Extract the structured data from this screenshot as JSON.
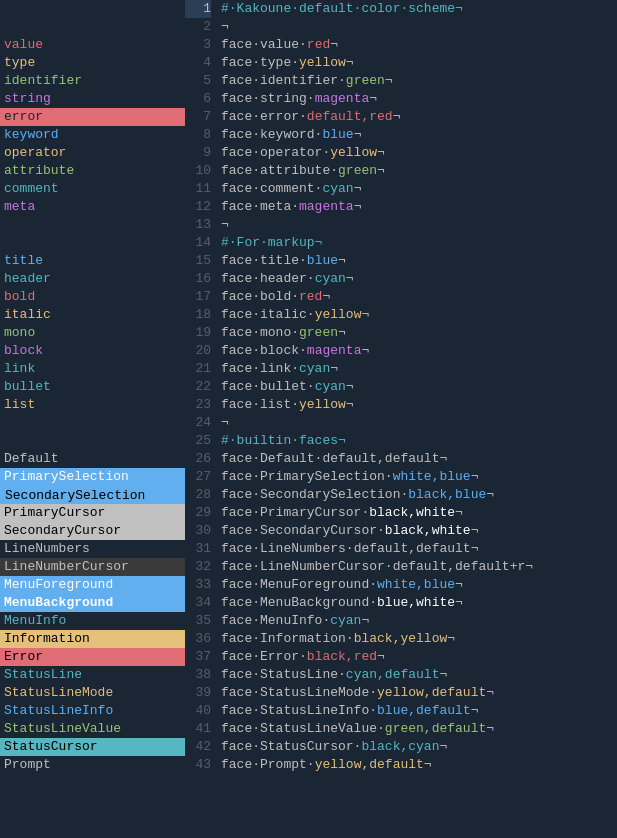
{
  "lines": [
    {
      "num": 1,
      "active": true,
      "left": "",
      "code": "#·Kakoune·default·color·scheme¬",
      "leftClass": "",
      "codeSegments": [
        {
          "text": "#·Kakoune·default·color·scheme¬",
          "cls": "c-comment"
        }
      ]
    },
    {
      "num": 2,
      "left": "",
      "code": "¬",
      "leftClass": "",
      "codeSegments": [
        {
          "text": "¬",
          "cls": "c-default"
        }
      ]
    },
    {
      "num": 3,
      "left": "value",
      "leftClass": "lbl-value",
      "code": "face·value·red¬",
      "codeSegments": [
        {
          "text": "face·",
          "cls": "c-default"
        },
        {
          "text": "value",
          "cls": "c-default"
        },
        {
          "text": "·",
          "cls": "c-default"
        },
        {
          "text": "red",
          "cls": "c-red"
        },
        {
          "text": "¬",
          "cls": "c-default"
        }
      ]
    },
    {
      "num": 4,
      "left": "type",
      "leftClass": "lbl-type",
      "code": "face·type·yellow¬",
      "codeSegments": [
        {
          "text": "face·type·",
          "cls": "c-default"
        },
        {
          "text": "yellow",
          "cls": "c-yellow"
        },
        {
          "text": "¬",
          "cls": "c-default"
        }
      ]
    },
    {
      "num": 5,
      "left": "identifier",
      "leftClass": "lbl-identifier",
      "code": "face·identifier·green¬",
      "codeSegments": [
        {
          "text": "face·identifier·",
          "cls": "c-default"
        },
        {
          "text": "green",
          "cls": "c-green"
        },
        {
          "text": "¬",
          "cls": "c-default"
        }
      ]
    },
    {
      "num": 6,
      "left": "string",
      "leftClass": "lbl-string",
      "code": "face·string·magenta¬",
      "codeSegments": [
        {
          "text": "face·string·",
          "cls": "c-default"
        },
        {
          "text": "magenta",
          "cls": "c-magenta"
        },
        {
          "text": "¬",
          "cls": "c-default"
        }
      ]
    },
    {
      "num": 7,
      "left": "error",
      "leftClass": "lbl-error",
      "code": "face·error·default,red¬",
      "codeSegments": [
        {
          "text": "face·error·",
          "cls": "c-default"
        },
        {
          "text": "default,red",
          "cls": "c-red"
        },
        {
          "text": "¬",
          "cls": "c-default"
        }
      ]
    },
    {
      "num": 8,
      "left": "keyword",
      "leftClass": "lbl-keyword",
      "code": "face·keyword·blue¬",
      "codeSegments": [
        {
          "text": "face·keyword·",
          "cls": "c-default"
        },
        {
          "text": "blue",
          "cls": "c-blue"
        },
        {
          "text": "¬",
          "cls": "c-default"
        }
      ]
    },
    {
      "num": 9,
      "left": "operator",
      "leftClass": "lbl-operator",
      "code": "face·operator·yellow¬",
      "codeSegments": [
        {
          "text": "face·operator·",
          "cls": "c-default"
        },
        {
          "text": "yellow",
          "cls": "c-yellow"
        },
        {
          "text": "¬",
          "cls": "c-default"
        }
      ]
    },
    {
      "num": 10,
      "left": "attribute",
      "leftClass": "lbl-attribute",
      "code": "face·attribute·green¬",
      "codeSegments": [
        {
          "text": "face·attribute·",
          "cls": "c-default"
        },
        {
          "text": "green",
          "cls": "c-green"
        },
        {
          "text": "¬",
          "cls": "c-default"
        }
      ]
    },
    {
      "num": 11,
      "left": "comment",
      "leftClass": "lbl-comment",
      "code": "face·comment·cyan¬",
      "codeSegments": [
        {
          "text": "face·comment·",
          "cls": "c-default"
        },
        {
          "text": "cyan",
          "cls": "c-cyan"
        },
        {
          "text": "¬",
          "cls": "c-default"
        }
      ]
    },
    {
      "num": 12,
      "left": "meta",
      "leftClass": "lbl-meta",
      "code": "face·meta·magenta¬",
      "codeSegments": [
        {
          "text": "face·meta·",
          "cls": "c-default"
        },
        {
          "text": "magenta",
          "cls": "c-magenta"
        },
        {
          "text": "¬",
          "cls": "c-default"
        }
      ]
    },
    {
      "num": 13,
      "left": "",
      "leftClass": "",
      "code": "¬",
      "codeSegments": [
        {
          "text": "¬",
          "cls": "c-default"
        }
      ]
    },
    {
      "num": 14,
      "left": "",
      "leftClass": "",
      "code": "#·For·markup¬",
      "codeSegments": [
        {
          "text": "#·For·markup¬",
          "cls": "c-comment"
        }
      ]
    },
    {
      "num": 15,
      "left": "title",
      "leftClass": "lbl-title",
      "code": "face·title·blue¬",
      "codeSegments": [
        {
          "text": "face·title·",
          "cls": "c-default"
        },
        {
          "text": "blue",
          "cls": "c-blue"
        },
        {
          "text": "¬",
          "cls": "c-default"
        }
      ]
    },
    {
      "num": 16,
      "left": "header",
      "leftClass": "lbl-header",
      "code": "face·header·cyan¬",
      "codeSegments": [
        {
          "text": "face·header·",
          "cls": "c-default"
        },
        {
          "text": "cyan",
          "cls": "c-cyan"
        },
        {
          "text": "¬",
          "cls": "c-default"
        }
      ]
    },
    {
      "num": 17,
      "left": "bold",
      "leftClass": "lbl-bold",
      "code": "face·bold·red¬",
      "codeSegments": [
        {
          "text": "face·bold·",
          "cls": "c-default"
        },
        {
          "text": "red",
          "cls": "c-red"
        },
        {
          "text": "¬",
          "cls": "c-default"
        }
      ]
    },
    {
      "num": 18,
      "left": "italic",
      "leftClass": "lbl-italic",
      "code": "face·italic·yellow¬",
      "codeSegments": [
        {
          "text": "face·italic·",
          "cls": "c-default"
        },
        {
          "text": "yellow",
          "cls": "c-yellow"
        },
        {
          "text": "¬",
          "cls": "c-default"
        }
      ]
    },
    {
      "num": 19,
      "left": "mono",
      "leftClass": "lbl-mono",
      "code": "face·mono·green¬",
      "codeSegments": [
        {
          "text": "face·mono·",
          "cls": "c-default"
        },
        {
          "text": "green",
          "cls": "c-green"
        },
        {
          "text": "¬",
          "cls": "c-default"
        }
      ]
    },
    {
      "num": 20,
      "left": "block",
      "leftClass": "lbl-block",
      "code": "face·block·magenta¬",
      "codeSegments": [
        {
          "text": "face·block·",
          "cls": "c-default"
        },
        {
          "text": "magenta",
          "cls": "c-magenta"
        },
        {
          "text": "¬",
          "cls": "c-default"
        }
      ]
    },
    {
      "num": 21,
      "left": "link",
      "leftClass": "lbl-link",
      "code": "face·link·cyan¬",
      "codeSegments": [
        {
          "text": "face·link·",
          "cls": "c-default"
        },
        {
          "text": "cyan",
          "cls": "c-cyan"
        },
        {
          "text": "¬",
          "cls": "c-default"
        }
      ]
    },
    {
      "num": 22,
      "left": "bullet",
      "leftClass": "lbl-bullet",
      "code": "face·bullet·cyan¬",
      "codeSegments": [
        {
          "text": "face·bullet·",
          "cls": "c-default"
        },
        {
          "text": "cyan",
          "cls": "c-cyan"
        },
        {
          "text": "¬",
          "cls": "c-default"
        }
      ]
    },
    {
      "num": 23,
      "left": "list",
      "leftClass": "lbl-list",
      "code": "face·list·yellow¬",
      "codeSegments": [
        {
          "text": "face·list·",
          "cls": "c-default"
        },
        {
          "text": "yellow",
          "cls": "c-yellow"
        },
        {
          "text": "¬",
          "cls": "c-default"
        }
      ]
    },
    {
      "num": 24,
      "left": "",
      "leftClass": "",
      "code": "¬",
      "codeSegments": [
        {
          "text": "¬",
          "cls": "c-default"
        }
      ]
    },
    {
      "num": 25,
      "left": "",
      "leftClass": "",
      "code": "#·builtin·faces¬",
      "codeSegments": [
        {
          "text": "#·builtin·faces¬",
          "cls": "c-comment"
        }
      ]
    },
    {
      "num": 26,
      "left": "Default",
      "leftClass": "lbl-default",
      "code": "face·Default·default,default¬",
      "codeSegments": [
        {
          "text": "face·Default·",
          "cls": "c-default"
        },
        {
          "text": "default,default",
          "cls": "c-default"
        },
        {
          "text": "¬",
          "cls": "c-default"
        }
      ]
    },
    {
      "num": 27,
      "left": "PrimarySelection",
      "leftClass": "lbl-primary-sel",
      "code": "face·PrimarySelection·white,blue¬",
      "codeSegments": [
        {
          "text": "face·PrimarySelection·",
          "cls": "c-default"
        },
        {
          "text": "white,blue",
          "cls": "c-blue"
        },
        {
          "text": "¬",
          "cls": "c-default"
        }
      ]
    },
    {
      "num": 28,
      "left": "SecondarySelection",
      "leftClass": "lbl-secondary-sel",
      "code": "face·SecondarySelection·black,blue¬",
      "codeSegments": [
        {
          "text": "face·SecondarySelection·",
          "cls": "c-default"
        },
        {
          "text": "black,blue",
          "cls": "c-blue"
        },
        {
          "text": "¬",
          "cls": "c-default"
        }
      ]
    },
    {
      "num": 29,
      "left": "PrimaryCursor",
      "leftClass": "lbl-primary-cursor",
      "code": "face·PrimaryCursor·black,white¬",
      "codeSegments": [
        {
          "text": "face·PrimaryCursor·",
          "cls": "c-default"
        },
        {
          "text": "black,white",
          "cls": "c-white"
        },
        {
          "text": "¬",
          "cls": "c-default"
        }
      ]
    },
    {
      "num": 30,
      "left": "SecondaryCursor",
      "leftClass": "lbl-secondary-cursor",
      "code": "face·SecondaryCursor·black,white¬",
      "codeSegments": [
        {
          "text": "face·SecondaryCursor·",
          "cls": "c-default"
        },
        {
          "text": "black,white",
          "cls": "c-white"
        },
        {
          "text": "¬",
          "cls": "c-default"
        }
      ]
    },
    {
      "num": 31,
      "left": "LineNumbers",
      "leftClass": "lbl-line-numbers",
      "code": "face·LineNumbers·default,default¬",
      "codeSegments": [
        {
          "text": "face·LineNumbers·",
          "cls": "c-default"
        },
        {
          "text": "default,default",
          "cls": "c-default"
        },
        {
          "text": "¬",
          "cls": "c-default"
        }
      ]
    },
    {
      "num": 32,
      "left": "LineNumberCursor",
      "leftClass": "lbl-line-number-cursor",
      "code": "face·LineNumberCursor·default,default+r¬",
      "codeSegments": [
        {
          "text": "face·LineNumberCursor·",
          "cls": "c-default"
        },
        {
          "text": "default,default+r",
          "cls": "c-default"
        },
        {
          "text": "¬",
          "cls": "c-default"
        }
      ]
    },
    {
      "num": 33,
      "left": "MenuForeground",
      "leftClass": "lbl-menu-fg",
      "code": "face·MenuForeground·white,blue¬",
      "codeSegments": [
        {
          "text": "face·MenuForeground·",
          "cls": "c-default"
        },
        {
          "text": "white,blue",
          "cls": "c-blue"
        },
        {
          "text": "¬",
          "cls": "c-default"
        }
      ]
    },
    {
      "num": 34,
      "left": "MenuBackground",
      "leftClass": "lbl-menu-bg",
      "code": "face·MenuBackground·blue,white¬",
      "codeSegments": [
        {
          "text": "face·MenuBackground·",
          "cls": "c-default"
        },
        {
          "text": "blue,white",
          "cls": "c-white"
        },
        {
          "text": "¬",
          "cls": "c-default"
        }
      ]
    },
    {
      "num": 35,
      "left": "MenuInfo",
      "leftClass": "lbl-menu-info",
      "code": "face·MenuInfo·cyan¬",
      "codeSegments": [
        {
          "text": "face·MenuInfo·",
          "cls": "c-default"
        },
        {
          "text": "cyan",
          "cls": "c-cyan"
        },
        {
          "text": "¬",
          "cls": "c-default"
        }
      ]
    },
    {
      "num": 36,
      "left": "Information",
      "leftClass": "lbl-information",
      "code": "face·Information·black,yellow¬",
      "codeSegments": [
        {
          "text": "face·Information·",
          "cls": "c-default"
        },
        {
          "text": "black,yellow",
          "cls": "c-yellow"
        },
        {
          "text": "¬",
          "cls": "c-default"
        }
      ]
    },
    {
      "num": 37,
      "left": "Error",
      "leftClass": "lbl-error2",
      "code": "face·Error·black,red¬",
      "codeSegments": [
        {
          "text": "face·Error·",
          "cls": "c-default"
        },
        {
          "text": "black,red",
          "cls": "c-red"
        },
        {
          "text": "¬",
          "cls": "c-default"
        }
      ]
    },
    {
      "num": 38,
      "left": "StatusLine",
      "leftClass": "lbl-status-line",
      "code": "face·StatusLine·cyan,default¬",
      "codeSegments": [
        {
          "text": "face·StatusLine·",
          "cls": "c-default"
        },
        {
          "text": "cyan,default",
          "cls": "c-cyan"
        },
        {
          "text": "¬",
          "cls": "c-default"
        }
      ]
    },
    {
      "num": 39,
      "left": "StatusLineMode",
      "leftClass": "lbl-status-line-mode",
      "code": "face·StatusLineMode·yellow,default¬",
      "codeSegments": [
        {
          "text": "face·StatusLineMode·",
          "cls": "c-default"
        },
        {
          "text": "yellow,default",
          "cls": "c-yellow"
        },
        {
          "text": "¬",
          "cls": "c-default"
        }
      ]
    },
    {
      "num": 40,
      "left": "StatusLineInfo",
      "leftClass": "lbl-status-line-info",
      "code": "face·StatusLineInfo·blue,default¬",
      "codeSegments": [
        {
          "text": "face·StatusLineInfo·",
          "cls": "c-default"
        },
        {
          "text": "blue,default",
          "cls": "c-blue"
        },
        {
          "text": "¬",
          "cls": "c-default"
        }
      ]
    },
    {
      "num": 41,
      "left": "StatusLineValue",
      "leftClass": "lbl-status-line-value",
      "code": "face·StatusLineValue·green,default¬",
      "codeSegments": [
        {
          "text": "face·StatusLineValue·",
          "cls": "c-default"
        },
        {
          "text": "green,default",
          "cls": "c-green"
        },
        {
          "text": "¬",
          "cls": "c-default"
        }
      ]
    },
    {
      "num": 42,
      "left": "StatusCursor",
      "leftClass": "lbl-status-cursor",
      "code": "face·StatusCursor·black,cyan¬",
      "codeSegments": [
        {
          "text": "face·StatusCursor·",
          "cls": "c-default"
        },
        {
          "text": "black,cyan",
          "cls": "c-cyan"
        },
        {
          "text": "¬",
          "cls": "c-default"
        }
      ]
    },
    {
      "num": 43,
      "left": "Prompt",
      "leftClass": "lbl-prompt",
      "code": "face·Prompt·yellow,default¬",
      "codeSegments": [
        {
          "text": "face·Prompt·",
          "cls": "c-default"
        },
        {
          "text": "yellow,default",
          "cls": "c-yellow"
        },
        {
          "text": "¬",
          "cls": "c-default"
        }
      ]
    }
  ]
}
